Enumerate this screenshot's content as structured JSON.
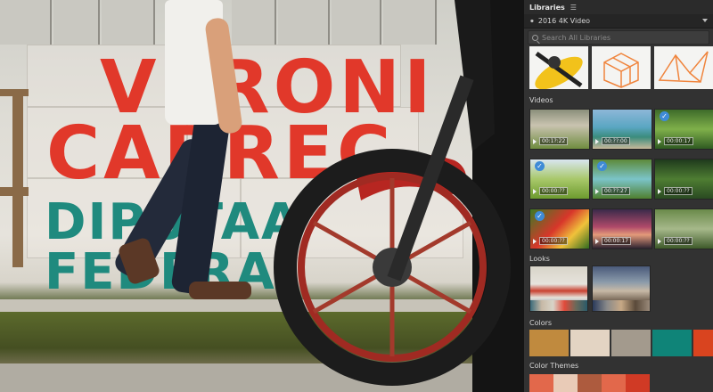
{
  "panel": {
    "title": "Libraries",
    "menu_icon": "hamburger-icon",
    "library_selector": {
      "icon": "library-icon",
      "label": "2016 4K Video"
    },
    "search": {
      "placeholder": "Search All Libraries",
      "value": ""
    },
    "sections": {
      "graphics_icons": [
        "kayak-graphic",
        "cube-graphic",
        "origami-bird-graphic"
      ],
      "videos": {
        "label": "Videos",
        "items": [
          {
            "thumb": "sheep",
            "time": "00:1?:22",
            "checked": false
          },
          {
            "thumb": "beach",
            "time": "00:??:00",
            "checked": false
          },
          {
            "thumb": "forest",
            "time": "00:00:17",
            "checked": true
          },
          {
            "thumb": "grass-field",
            "time": "00:00:??",
            "checked": true
          },
          {
            "thumb": "waterfall",
            "time": "00:??:27",
            "checked": true
          },
          {
            "thumb": "jungle",
            "time": "00:00:??",
            "checked": false
          },
          {
            "thumb": "parrot",
            "time": "00:00:??",
            "checked": true
          },
          {
            "thumb": "sunset-sky",
            "time": "00:00:17",
            "checked": false
          },
          {
            "thumb": "woods",
            "time": "00:00:??",
            "checked": false
          }
        ]
      },
      "looks": {
        "label": "Looks",
        "items": [
          "wall-look",
          "sky-look"
        ]
      },
      "colors": {
        "label": "Colors",
        "swatches": [
          "#c08a3e",
          "#e3d4c3",
          "#a39a8d",
          "#0f8478",
          "#d9441f"
        ]
      },
      "color_themes": {
        "label": "Color Themes",
        "swatches": [
          "#e2684b",
          "#e9cbb7",
          "#ad5b3e",
          "#e2684b",
          "#d03a25"
        ]
      }
    }
  },
  "preview": {
    "wall_text_line1": "VERONI",
    "wall_text_line2": "CARREC",
    "wall_text_line3": "DIPUTAA  FEDERA"
  }
}
